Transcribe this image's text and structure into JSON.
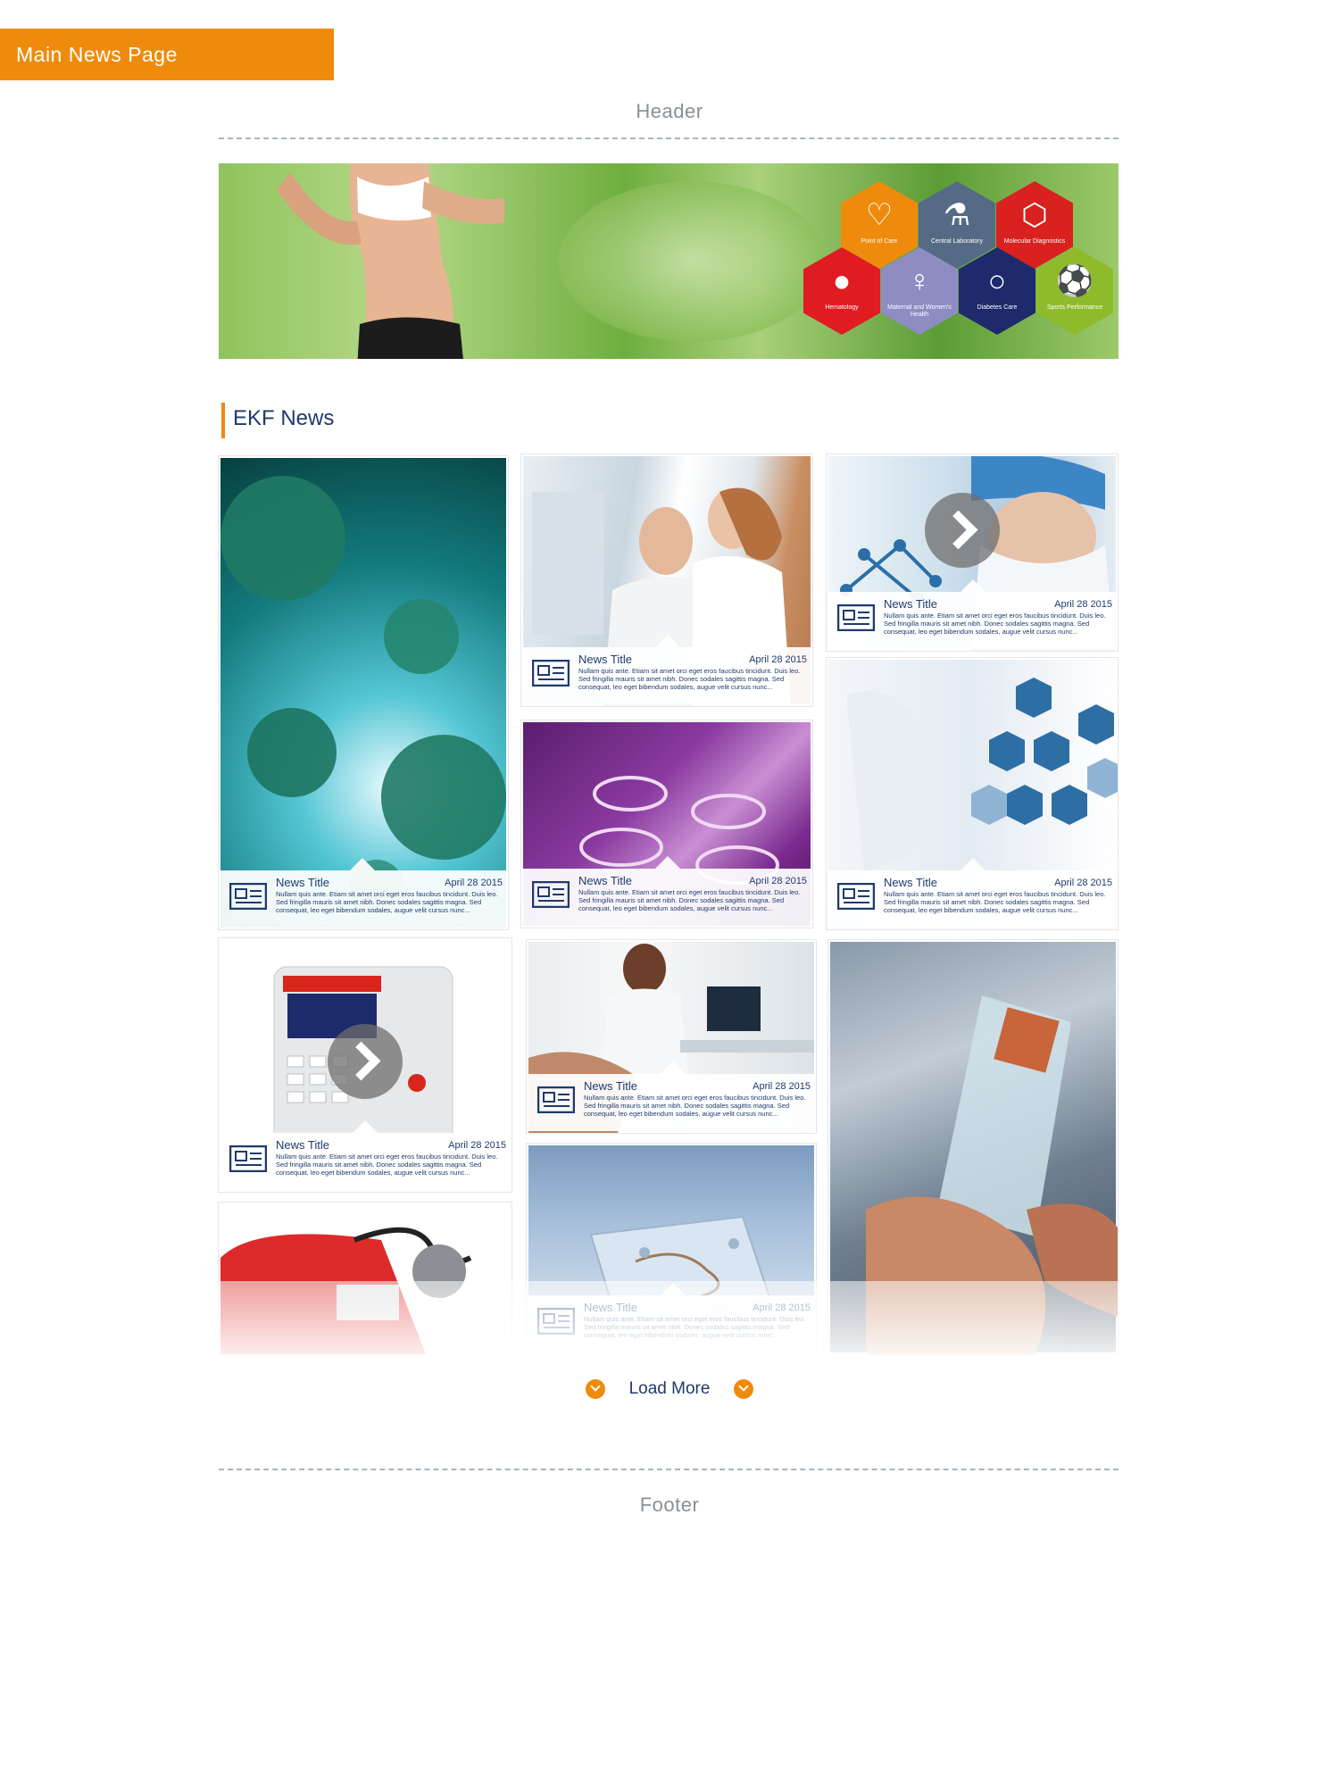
{
  "page_tab": "Main News Page",
  "header_label": "Header",
  "footer_label": "Footer",
  "hero": {
    "tiles": [
      {
        "label": "Point of Care",
        "color": "#ef8b0c",
        "icon": "heart-pulse-icon"
      },
      {
        "label": "Central Laboratory",
        "color": "#556b85",
        "icon": "flask-icon"
      },
      {
        "label": "Molecular Diagnostics",
        "color": "#d9211f",
        "icon": "molecule-icon"
      },
      {
        "label": "Hematology",
        "color": "#e11b22",
        "icon": "blood-drop-icon"
      },
      {
        "label": "Maternal and Women's Health",
        "color": "#8e8cc3",
        "icon": "female-icon"
      },
      {
        "label": "Diabetes Care",
        "color": "#1e2a6b",
        "icon": "ring-icon"
      },
      {
        "label": "Sports Performance",
        "color": "#8dbb2b",
        "icon": "soccer-ball-icon"
      }
    ]
  },
  "section_title": "EKF News",
  "news_card": {
    "title": "News Title",
    "date": "April 28 2015",
    "body": "Nullam quis ante. Etiam sit amet orci eget eros faucibus tincidunt. Duis leo. Sed fringilla mauris sit amet nibh. Donec sodales sagittis magna. Sed consequat, leo eget bibendum sodales, augue velit cursus nunc..."
  },
  "load_more": "Load More",
  "colors": {
    "accent": "#ef8b0c",
    "navy": "#1e3a6e"
  }
}
